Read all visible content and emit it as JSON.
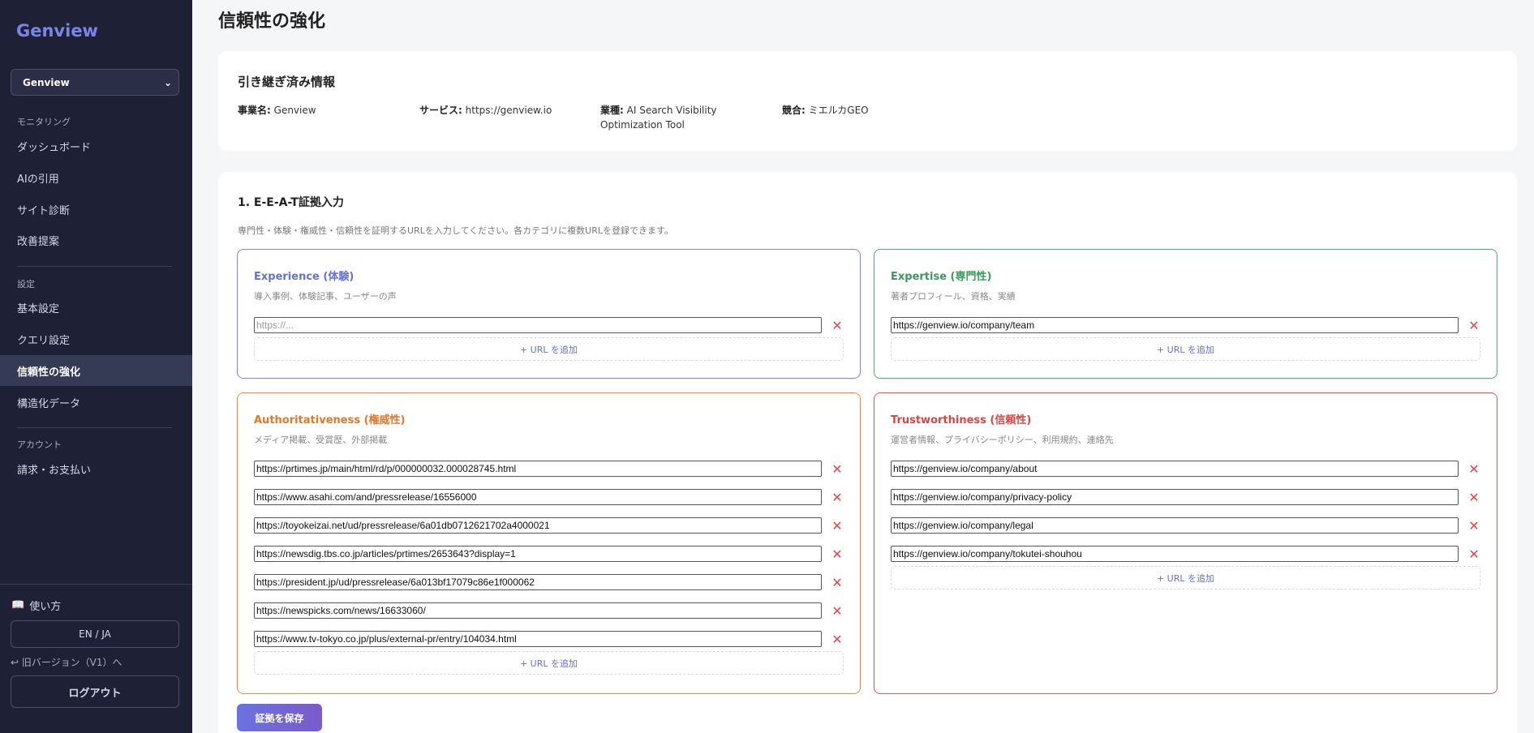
{
  "sidebar": {
    "logo": "Genview",
    "project": "Genview",
    "sections": {
      "monitoring": "モニタリング",
      "settings": "設定",
      "account": "アカウント"
    },
    "items": {
      "dashboard": "ダッシュボード",
      "ai_citations": "AIの引用",
      "site_diagnosis": "サイト診断",
      "improvements": "改善提案",
      "basic_settings": "基本設定",
      "query_settings": "クエリ設定",
      "trust": "信頼性の強化",
      "structured_data": "構造化データ",
      "billing": "請求・お支払い"
    },
    "howto": "使い方",
    "lang": "EN / JA",
    "old_version": "↩ 旧バージョン（V1）へ",
    "logout": "ログアウト"
  },
  "page": {
    "title": "信頼性の強化"
  },
  "inherited": {
    "title": "引き継ぎ済み情報",
    "business_label": "事業名:",
    "business_value": "Genview",
    "service_label": "サービス:",
    "service_value": "https://genview.io",
    "industry_label": "業種:",
    "industry_value": "AI Search Visibility Optimization Tool",
    "competitor_label": "競合:",
    "competitor_value": "ミエルカGEO"
  },
  "eeat": {
    "title": "1. E-E-A-T証拠入力",
    "description": "専門性・体験・権威性・信頼性を証明するURLを入力してください。各カテゴリに複数URLを登録できます。",
    "add_url_label": "+ URL を追加",
    "save_label": "証拠を保存",
    "experience": {
      "title": "Experience (体験)",
      "desc": "導入事例、体験記事、ユーザーの声",
      "placeholder": "https://...",
      "urls": [
        ""
      ]
    },
    "expertise": {
      "title": "Expertise (専門性)",
      "desc": "著者プロフィール、資格、実績",
      "urls": [
        "https://genview.io/company/team"
      ]
    },
    "authoritativeness": {
      "title": "Authoritativeness (権威性)",
      "desc": "メディア掲載、受賞歴、外部掲載",
      "urls": [
        "https://prtimes.jp/main/html/rd/p/000000032.000028745.html",
        "https://www.asahi.com/and/pressrelease/16556000",
        "https://toyokeizai.net/ud/pressrelease/6a01db0712621702a4000021",
        "https://newsdig.tbs.co.jp/articles/prtimes/2653643?display=1",
        "https://president.jp/ud/pressrelease/6a013bf17079c86e1f000062",
        "https://newspicks.com/news/16633060/",
        "https://www.tv-tokyo.co.jp/plus/external-pr/entry/104034.html"
      ]
    },
    "trustworthiness": {
      "title": "Trustworthiness (信頼性)",
      "desc": "運営者情報、プライバシーポリシー、利用規約、連絡先",
      "urls": [
        "https://genview.io/company/about",
        "https://genview.io/company/privacy-policy",
        "https://genview.io/company/legal",
        "https://genview.io/company/tokutei-shouhou"
      ]
    }
  },
  "icons": {
    "delete": "close-icon",
    "dropdown": "chevron-down-icon",
    "book": "book-icon"
  },
  "colors": {
    "sidebar_bg": "#1e2136",
    "accent": "#6670d8",
    "experience": "#7b85e8",
    "expertise": "#4caf6e",
    "authoritativeness": "#f08a3c",
    "trustworthiness": "#e25858",
    "delete": "#e04848"
  }
}
